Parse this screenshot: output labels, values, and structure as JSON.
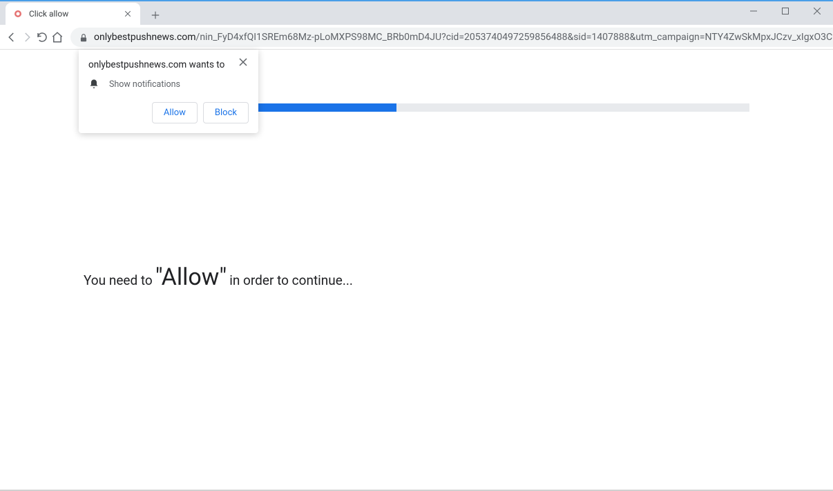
{
  "window": {
    "tab_title": "Click allow"
  },
  "toolbar": {
    "url_domain": "onlybestpushnews.com",
    "url_path": "/nin_FyD4xfQI1SREm68Mz-pLoMXPS98MC_BRb0mD4JU?cid=2053740497259856488&sid=1407888&utm_campaign=NTY4ZwSkMpxJCzv_xIgxO3C2M..."
  },
  "popup": {
    "origin_text": "onlybestpushnews.com wants to",
    "permission_label": "Show notifications",
    "allow_label": "Allow",
    "block_label": "Block"
  },
  "page": {
    "text_before": "You need to ",
    "text_emphasis": "\"Allow\"",
    "text_after": " in order to continue..."
  }
}
